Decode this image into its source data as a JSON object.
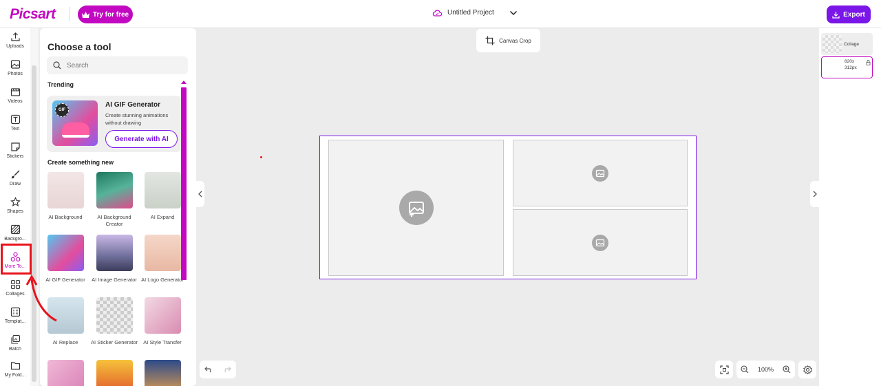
{
  "header": {
    "logo": "Picsart",
    "try_button": "Try for free",
    "project_name": "Untitled Project",
    "export_button": "Export"
  },
  "rail": {
    "items": [
      {
        "label": "Uploads",
        "icon": "upload-icon"
      },
      {
        "label": "Photos",
        "icon": "image-icon"
      },
      {
        "label": "Videos",
        "icon": "video-icon"
      },
      {
        "label": "Text",
        "icon": "text-icon"
      },
      {
        "label": "Stickers",
        "icon": "sticker-icon"
      },
      {
        "label": "Draw",
        "icon": "brush-icon"
      },
      {
        "label": "Shapes",
        "icon": "star-icon"
      },
      {
        "label": "Backgro...",
        "icon": "background-icon"
      },
      {
        "label": "More To...",
        "icon": "more-tools-icon",
        "active": true
      },
      {
        "label": "Collages",
        "icon": "collage-icon"
      },
      {
        "label": "Templat...",
        "icon": "template-icon"
      },
      {
        "label": "Batch",
        "icon": "batch-icon"
      },
      {
        "label": "My Fold...",
        "icon": "folder-icon"
      }
    ]
  },
  "panel": {
    "title": "Choose a tool",
    "search_placeholder": "Search",
    "trending_title": "Trending",
    "featured": {
      "title": "AI GIF Generator",
      "description": "Create stunning animations without drawing",
      "button": "Generate with AI",
      "badge": "GIF"
    },
    "create_title": "Create something new",
    "tools": [
      {
        "label": "AI Background"
      },
      {
        "label": "AI Background Creator"
      },
      {
        "label": "AI Expand"
      },
      {
        "label": "AI GIF Generator"
      },
      {
        "label": "AI Image Generator"
      },
      {
        "label": "AI Logo Generator"
      },
      {
        "label": "AI Replace"
      },
      {
        "label": "AI Sticker Generator"
      },
      {
        "label": "AI Style Transfer"
      }
    ]
  },
  "canvas": {
    "crop_button": "Canvas Crop",
    "zoom": "100%"
  },
  "layers": {
    "items": [
      {
        "label": "Collage"
      },
      {
        "label": "820x 312px"
      }
    ]
  },
  "colors": {
    "brand": "#c209c1",
    "accent": "#7a16e8",
    "highlight": "#e8121b"
  }
}
